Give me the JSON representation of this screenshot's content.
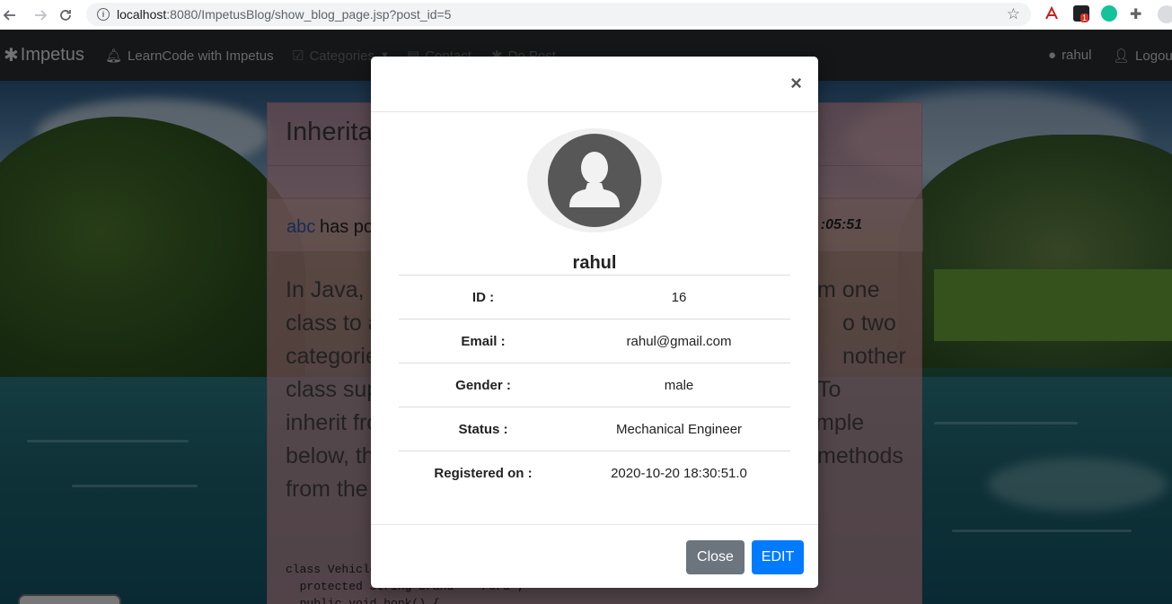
{
  "browser": {
    "url_host": "localhost",
    "url_rest": ":8080/ImpetusBlog/show_blog_page.jsp?post_id=5",
    "back_icon": "arrow-left-icon",
    "forward_icon": "arrow-right-icon",
    "reload_icon": "reload-icon",
    "bookmark_icon": "star-icon",
    "extension_badge": "1"
  },
  "navbar": {
    "brand": "Impetus",
    "links": [
      {
        "label": "LearnCode with Impetus",
        "icon": "bell-icon"
      },
      {
        "label": "Categories",
        "icon": "check-square-icon"
      },
      {
        "label": "Contact",
        "icon": "address-card-icon"
      },
      {
        "label": "Do Post",
        "icon": "asterisk-icon"
      }
    ],
    "user": "rahul",
    "logout": "Logout"
  },
  "blog": {
    "title_visible": "Inherita",
    "author": "abc",
    "posted_text": "has po",
    "time_visible": ":05:51",
    "lines_left": [
      "In Java, it",
      "class to a",
      "categorie",
      "class supe",
      "inherit fro",
      "below, th",
      "from the"
    ],
    "lines_right": [
      "m one",
      "o two",
      "nother",
      "To",
      "mple",
      "methods",
      ""
    ],
    "code": "class Vehicle\n  protected String brand = \"Ford\";\n  public void honk() {"
  },
  "modal": {
    "close_symbol": "×",
    "name": "rahul",
    "rows": [
      {
        "label": "ID :",
        "value": "16"
      },
      {
        "label": "Email :",
        "value": "rahul@gmail.com"
      },
      {
        "label": "Gender :",
        "value": "male"
      },
      {
        "label": "Status :",
        "value": "Mechanical Engineer"
      },
      {
        "label": "Registered on :",
        "value": "2020-10-20 18:30:51.0"
      }
    ],
    "close_button": "Close",
    "edit_button": "EDIT",
    "colors": {
      "close": "#6c757d",
      "edit": "#007bff"
    }
  }
}
